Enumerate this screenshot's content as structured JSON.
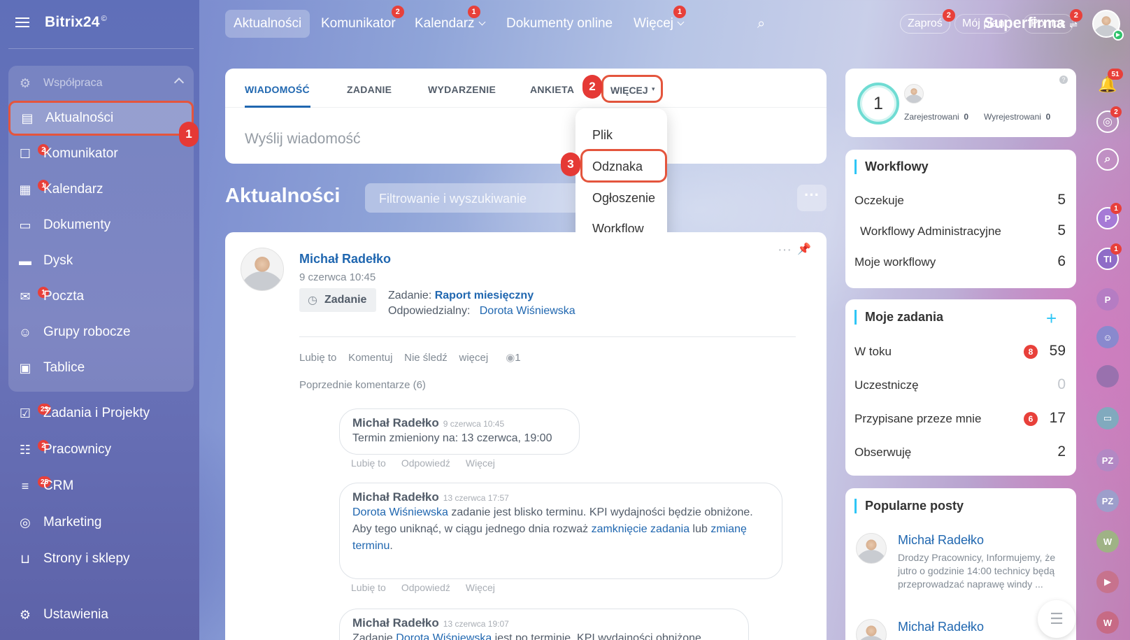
{
  "sidebar": {
    "logo": "Bitrix24",
    "logo_mark": "©",
    "group_label": "Współpraca",
    "items": [
      {
        "label": "Aktualności",
        "badge": ""
      },
      {
        "label": "Komunikator",
        "badge": "2"
      },
      {
        "label": "Kalendarz",
        "badge": "1"
      },
      {
        "label": "Dokumenty",
        "badge": ""
      },
      {
        "label": "Dysk",
        "badge": ""
      },
      {
        "label": "Poczta",
        "badge": "1"
      },
      {
        "label": "Grupy robocze",
        "badge": ""
      },
      {
        "label": "Tablice",
        "badge": ""
      },
      {
        "label": "Zadania i Projekty",
        "badge": "23"
      },
      {
        "label": "Pracownicy",
        "badge": "2"
      },
      {
        "label": "CRM",
        "badge": "25"
      },
      {
        "label": "Marketing",
        "badge": ""
      },
      {
        "label": "Strony i sklepy",
        "badge": ""
      }
    ],
    "settings": "Ustawienia"
  },
  "steps": {
    "one": "1",
    "two": "2",
    "three": "3"
  },
  "topbar": {
    "nav": [
      {
        "label": "Aktualności",
        "badge": ""
      },
      {
        "label": "Komunikator",
        "badge": "2"
      },
      {
        "label": "Kalendarz",
        "badge": "1"
      },
      {
        "label": "Dokumenty online",
        "badge": ""
      },
      {
        "label": "Więcej",
        "badge": "1"
      }
    ],
    "company": "Superfirma",
    "invite": "Zaproś",
    "invite_badge": "2",
    "plan": "Mój plan",
    "help": "Pomoc",
    "help_badge": "2"
  },
  "composer": {
    "tabs": [
      "WIADOMOŚĆ",
      "ZADANIE",
      "WYDARZENIE",
      "ANKIETA",
      "WIĘCEJ"
    ],
    "placeholder": "Wyślij wiadomość",
    "more_menu": [
      "Plik",
      "Odznaka",
      "Ogłoszenie",
      "Workflow"
    ]
  },
  "feed": {
    "title": "Aktualności",
    "filter_placeholder": "Filtrowanie i wyszukiwanie",
    "post": {
      "author": "Michał Radełko",
      "date": "9 czerwca 10:45",
      "type_label": "Zadanie",
      "task_prefix": "Zadanie:",
      "task_name": "Raport miesięczny",
      "resp_label": "Odpowiedzialny:",
      "resp_name": "Dorota Wiśniewska",
      "actions": {
        "like": "Lubię to",
        "comment": "Komentuj",
        "unfollow": "Nie śledź",
        "more": "więcej",
        "views": "1"
      },
      "prev_comments": "Poprzednie komentarze (6)",
      "comment_actions": {
        "like": "Lubię to",
        "reply": "Odpowiedź",
        "more": "Więcej"
      },
      "comments": [
        {
          "author": "Michał Radełko",
          "time": "9 czerwca 10:45",
          "text": "Termin zmieniony na: 13 czerwca, 19:00"
        },
        {
          "author": "Michał Radełko",
          "time": "13 czerwca 17:57",
          "mention": "Dorota Wiśniewska",
          "text1": "zadanie jest blisko terminu. KPI wydajności będzie obniżone.",
          "text2": "Aby tego uniknąć, w ciągu jednego dnia rozważ",
          "link1": "zamknięcie zadania",
          "mid": "lub",
          "link2": "zmianę terminu",
          "end": "."
        },
        {
          "author": "Michał Radełko",
          "time": "13 czerwca 19:07",
          "prefix": "Zadanie",
          "mention": "Dorota Wiśniewska",
          "text": "jest po terminie. KPI wydajności obniżone"
        }
      ]
    }
  },
  "right": {
    "online_count": "1",
    "registered_label": "Zarejestrowani",
    "registered_count": "0",
    "unregistered_label": "Wyrejestrowani",
    "unregistered_count": "0",
    "workflow": {
      "title": "Workflowy",
      "rows": [
        {
          "label": "Oczekuje",
          "value": "5"
        },
        {
          "label": "Workflowy Administracyjne",
          "value": "5"
        },
        {
          "label": "Moje workflowy",
          "value": "6"
        }
      ]
    },
    "tasks": {
      "title": "Moje zadania",
      "rows": [
        {
          "label": "W toku",
          "badge": "8",
          "value": "59"
        },
        {
          "label": "Uczestniczę",
          "badge": "",
          "value": "0"
        },
        {
          "label": "Przypisane przeze mnie",
          "badge": "6",
          "value": "17"
        },
        {
          "label": "Obserwuję",
          "badge": "",
          "value": "2"
        }
      ]
    },
    "popular": {
      "title": "Popularne posty",
      "author": "Michał Radełko",
      "text": "Drodzy Pracownicy, Informujemy, że jutro o godzinie 14:00 technicy będą przeprowadzać naprawę windy ...",
      "author2": "Michał Radełko"
    }
  },
  "rail": {
    "notif_badge": "51",
    "second_badge": "2",
    "chats": [
      {
        "initials": "P",
        "badge": "1"
      },
      {
        "initials": "TI",
        "badge": "1"
      },
      {
        "initials": "P",
        "badge": ""
      },
      {
        "initials": "PZ",
        "badge": ""
      },
      {
        "initials": "PZ",
        "badge": ""
      },
      {
        "initials": "W",
        "badge": ""
      },
      {
        "initials": "W",
        "badge": ""
      }
    ]
  },
  "colors": {
    "accent": "#2067b0",
    "highlight": "#e4553d",
    "badge": "#e8403a"
  }
}
